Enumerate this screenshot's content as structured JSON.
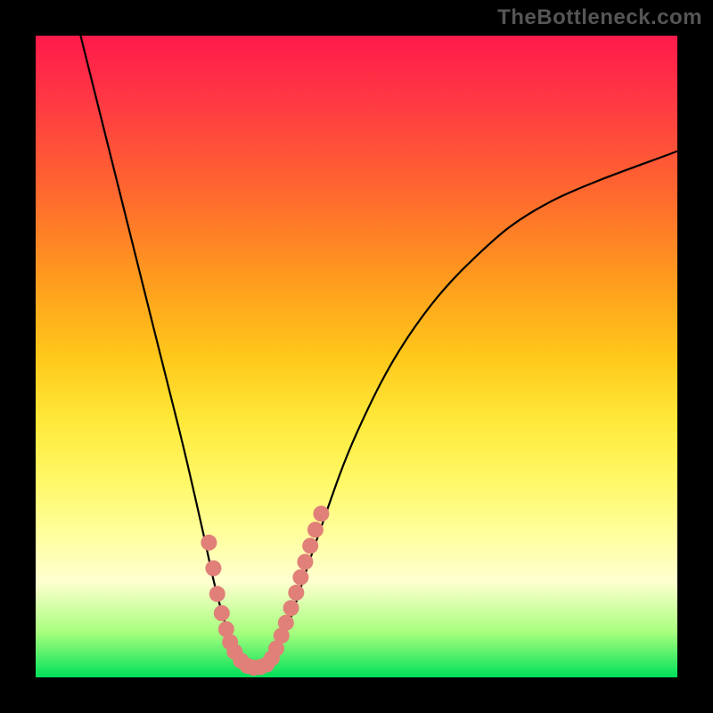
{
  "watermark": "TheBottleneck.com",
  "chart_data": {
    "type": "line",
    "title": "",
    "xlabel": "",
    "ylabel": "",
    "xlim": [
      0,
      100
    ],
    "ylim": [
      0,
      100
    ],
    "grid": false,
    "legend": false,
    "curve_left": {
      "name": "bottleneck-left-branch",
      "color": "#000000",
      "points": [
        {
          "x": 7,
          "y": 100
        },
        {
          "x": 11,
          "y": 84
        },
        {
          "x": 15,
          "y": 68
        },
        {
          "x": 19,
          "y": 52
        },
        {
          "x": 23,
          "y": 36
        },
        {
          "x": 26,
          "y": 23
        },
        {
          "x": 28,
          "y": 14
        },
        {
          "x": 30,
          "y": 7
        },
        {
          "x": 32,
          "y": 2.5
        },
        {
          "x": 34,
          "y": 1.5
        }
      ]
    },
    "curve_right": {
      "name": "bottleneck-right-branch",
      "color": "#000000",
      "points": [
        {
          "x": 34,
          "y": 1.5
        },
        {
          "x": 36,
          "y": 2
        },
        {
          "x": 38,
          "y": 5
        },
        {
          "x": 40,
          "y": 10
        },
        {
          "x": 44,
          "y": 22
        },
        {
          "x": 50,
          "y": 38
        },
        {
          "x": 58,
          "y": 53
        },
        {
          "x": 68,
          "y": 65
        },
        {
          "x": 80,
          "y": 74
        },
        {
          "x": 100,
          "y": 82
        }
      ]
    },
    "markers": {
      "name": "highlighted-points",
      "color": "#e08078",
      "radius": 9,
      "points": [
        {
          "x": 27,
          "y": 21
        },
        {
          "x": 27.7,
          "y": 17
        },
        {
          "x": 28.3,
          "y": 13
        },
        {
          "x": 29,
          "y": 10
        },
        {
          "x": 29.7,
          "y": 7.5
        },
        {
          "x": 30.3,
          "y": 5.5
        },
        {
          "x": 31,
          "y": 4
        },
        {
          "x": 32,
          "y": 2.6
        },
        {
          "x": 33,
          "y": 1.8
        },
        {
          "x": 34,
          "y": 1.5
        },
        {
          "x": 35,
          "y": 1.6
        },
        {
          "x": 36,
          "y": 2
        },
        {
          "x": 36.8,
          "y": 3
        },
        {
          "x": 37.5,
          "y": 4.5
        },
        {
          "x": 38.3,
          "y": 6.5
        },
        {
          "x": 39,
          "y": 8.5
        },
        {
          "x": 39.8,
          "y": 10.8
        },
        {
          "x": 40.6,
          "y": 13.2
        },
        {
          "x": 41.3,
          "y": 15.6
        },
        {
          "x": 42,
          "y": 18
        },
        {
          "x": 42.8,
          "y": 20.5
        },
        {
          "x": 43.6,
          "y": 23
        },
        {
          "x": 44.5,
          "y": 25.5
        }
      ]
    }
  }
}
